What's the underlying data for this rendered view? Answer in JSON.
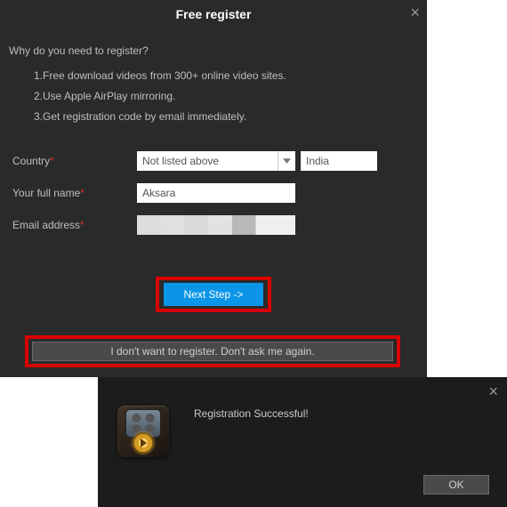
{
  "dialog1": {
    "title": "Free register",
    "heading": "Why do you need to register?",
    "reasons": [
      "1.Free download videos from 300+ online video sites.",
      "2.Use Apple AirPlay mirroring.",
      "3.Get registration code by email immediately."
    ],
    "fields": {
      "country": {
        "label": "Country",
        "value": "Not listed above",
        "secondary": "India"
      },
      "name": {
        "label": "Your full name",
        "value": "Aksara"
      },
      "email": {
        "label": "Email address"
      }
    },
    "buttons": {
      "primary": "Next Step ->",
      "secondary": "I don't want to register. Don't ask me again."
    }
  },
  "dialog2": {
    "message": "Registration Successful!",
    "ok": "OK"
  }
}
